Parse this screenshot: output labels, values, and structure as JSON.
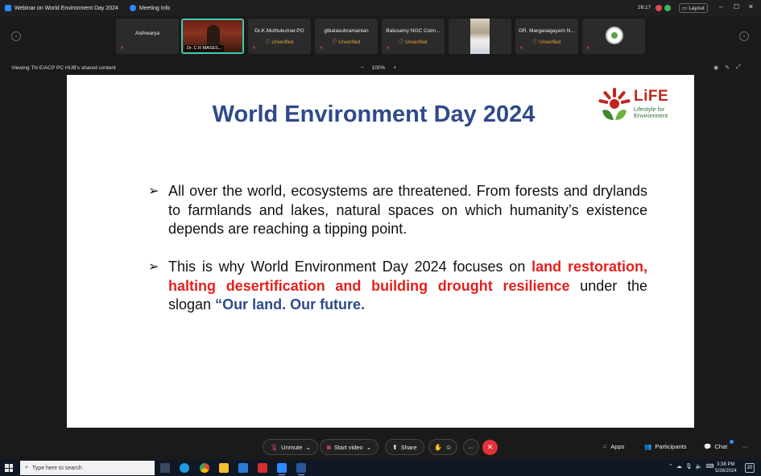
{
  "window": {
    "title": "Webinar on World Environment Day 2024",
    "meeting_info": "Meeting Info",
    "timer": "26:17",
    "layout_label": "Layout",
    "controls": [
      "–",
      "☐",
      "✕"
    ]
  },
  "participants": [
    {
      "name": "Aishwarya",
      "status": ""
    },
    {
      "name": "Dr. C.R MASES...",
      "status": "video"
    },
    {
      "name": "Dr.K.Muthukumar.PO",
      "status": "Unverified"
    },
    {
      "name": "gtbalasubramanian",
      "status": "Unverified"
    },
    {
      "name": "Balusamy NGC Coim...",
      "status": "Unverified"
    },
    {
      "name": "",
      "status": "photo"
    },
    {
      "name": "DR. Margasagayam N...",
      "status": "Unverified"
    },
    {
      "name": "",
      "status": "logo"
    }
  ],
  "viewbar": {
    "sharing_text": "Viewing TN EIACP PC HUB's shared content",
    "zoom_minus": "−",
    "zoom_level": "100%",
    "zoom_plus": "+"
  },
  "slide": {
    "title": "World Environment Day 2024",
    "logo": {
      "word": "LiFE",
      "sub_line1": "Lifestyle for",
      "sub_line2": "Environment"
    },
    "bullet1": "All over the world, ecosystems are threatened. From forests and drylands to farmlands and lakes, natural spaces on which humanity’s existence depends are reaching a tipping point.",
    "bullet2_plain": "This is why World Environment Day 2024 focuses on",
    "bullet2_red": "land restoration, halting desertification and building drought resilience",
    "bullet2_mid": "under the slogan",
    "bullet2_blue": "“Our land. Our future."
  },
  "controls": {
    "unmute": "Unmute",
    "start_video": "Start video",
    "share": "Share",
    "more": "···",
    "end": "✕",
    "apps": "Apps",
    "participants": "Participants",
    "chat": "Chat"
  },
  "taskbar": {
    "search_placeholder": "Type here to search",
    "time": "3:38 PM",
    "date": "5/26/2024",
    "notifications": "20"
  },
  "colors": {
    "slide_title": "#2f4a8a",
    "highlight_red": "#e5201c",
    "end_call": "#e5313a",
    "active_speaker": "#3cc8b4"
  }
}
